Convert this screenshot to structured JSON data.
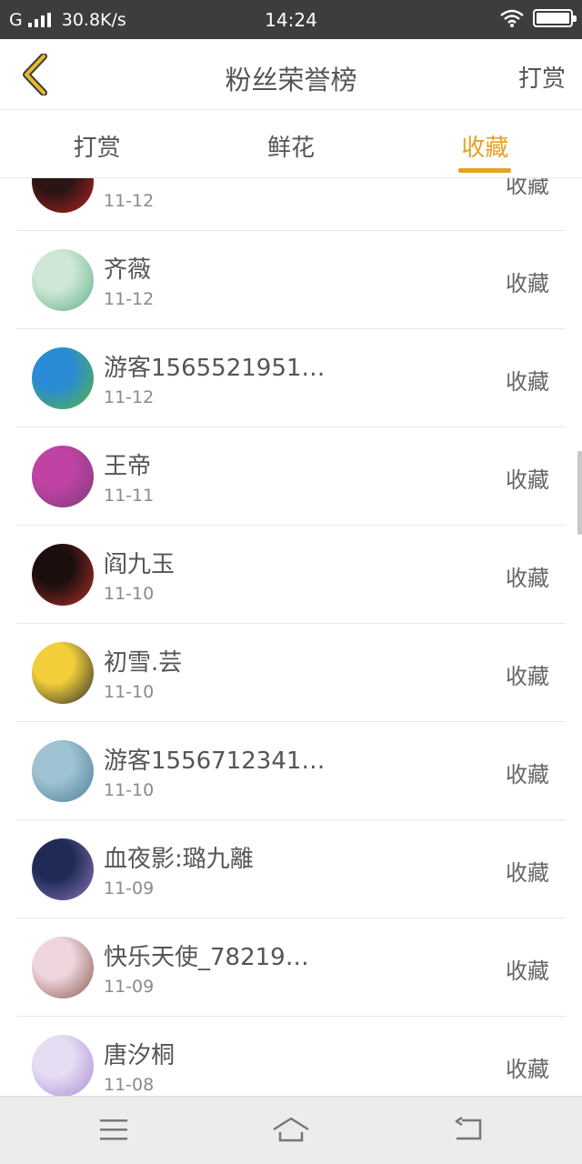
{
  "status_bar": {
    "carrier": "G",
    "net_speed": "30.8K/s",
    "time": "14:24"
  },
  "header": {
    "title": "粉丝荣誉榜",
    "action_label": "打赏"
  },
  "tabs": [
    {
      "label": "打赏",
      "active": false
    },
    {
      "label": "鲜花",
      "active": false
    },
    {
      "label": "收藏",
      "active": true
    }
  ],
  "list": [
    {
      "name": "",
      "date": "11-12",
      "action": "收藏",
      "avatar_colors": [
        "#2a1414",
        "#b32424"
      ]
    },
    {
      "name": "齐薇",
      "date": "11-12",
      "action": "收藏",
      "avatar_colors": [
        "#cfe7d6",
        "#5fb08a"
      ]
    },
    {
      "name": "游客1565521951…",
      "date": "11-12",
      "action": "收藏",
      "avatar_colors": [
        "#2a8bd6",
        "#56b63c"
      ]
    },
    {
      "name": "王帝",
      "date": "11-11",
      "action": "收藏",
      "avatar_colors": [
        "#c043a4",
        "#7d3a7a"
      ]
    },
    {
      "name": "阎九玉",
      "date": "11-10",
      "action": "收藏",
      "avatar_colors": [
        "#1d0e0e",
        "#b0302a"
      ]
    },
    {
      "name": "初雪.芸",
      "date": "11-10",
      "action": "收藏",
      "avatar_colors": [
        "#f2cf3a",
        "#2b2b2b"
      ]
    },
    {
      "name": "游客1556712341…",
      "date": "11-10",
      "action": "收藏",
      "avatar_colors": [
        "#9fc3d3",
        "#4a7f95"
      ]
    },
    {
      "name": "血夜影:璐九離",
      "date": "11-09",
      "action": "收藏",
      "avatar_colors": [
        "#1f2a55",
        "#8a75b8"
      ]
    },
    {
      "name": "快乐天使_78219…",
      "date": "11-09",
      "action": "收藏",
      "avatar_colors": [
        "#efd6de",
        "#8a5a4a"
      ]
    },
    {
      "name": "唐汐桐",
      "date": "11-08",
      "action": "收藏",
      "avatar_colors": [
        "#e6dcf4",
        "#a78ed6"
      ]
    }
  ],
  "colors": {
    "accent": "#e8a021",
    "status_bar": "#3d3d3d",
    "navbar": "#ececec"
  },
  "icons": {
    "back": "chevron-left-icon",
    "menu": "menu-icon",
    "home": "home-icon",
    "return": "return-icon"
  }
}
